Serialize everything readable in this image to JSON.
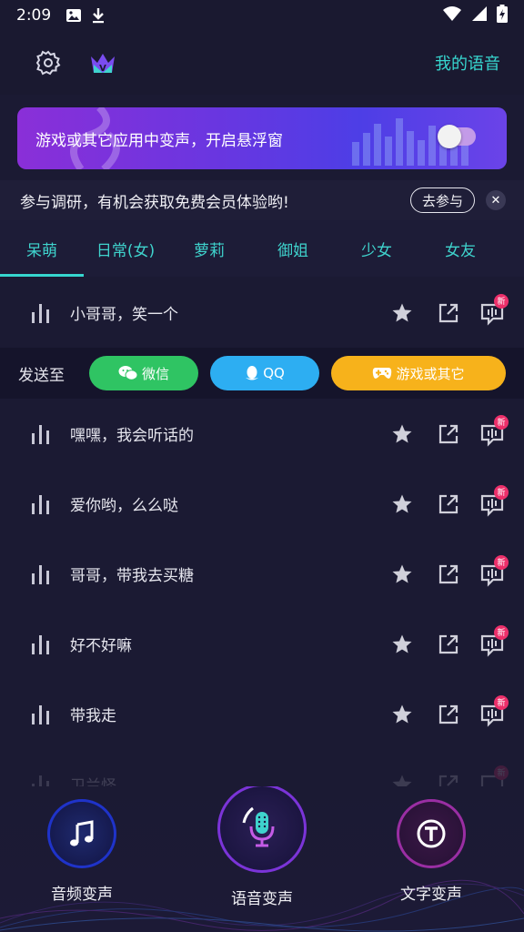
{
  "status_bar": {
    "time": "2:09"
  },
  "header": {
    "my_voice": "我的语音"
  },
  "banner": {
    "text": "游戏或其它应用中变声，开启悬浮窗"
  },
  "survey": {
    "text": "参与调研，有机会获取免费会员体验哟!",
    "join_label": "去参与"
  },
  "tabs": [
    {
      "label": "呆萌"
    },
    {
      "label": "日常(女)"
    },
    {
      "label": "萝莉"
    },
    {
      "label": "御姐"
    },
    {
      "label": "少女"
    },
    {
      "label": "女友"
    }
  ],
  "voices": [
    {
      "label": "小哥哥，笑一个"
    },
    {
      "label": "嘿嘿，我会听话的"
    },
    {
      "label": "爱你哟，么么哒"
    },
    {
      "label": "哥哥，带我去买糖"
    },
    {
      "label": "好不好嘛"
    },
    {
      "label": "带我走"
    },
    {
      "label": "卫兰怪"
    }
  ],
  "badge": "新",
  "send_bar": {
    "label": "发送至",
    "wechat": "微信",
    "qq": "QQ",
    "game": "游戏或其它"
  },
  "bottom_nav": {
    "audio": "音频变声",
    "voice": "语音变声",
    "text": "文字变声"
  },
  "colors": {
    "accent": "#37d7d0",
    "wechat": "#2fc463",
    "qq": "#2daef2",
    "game": "#f7b21b",
    "badge": "#ec2f6a"
  }
}
